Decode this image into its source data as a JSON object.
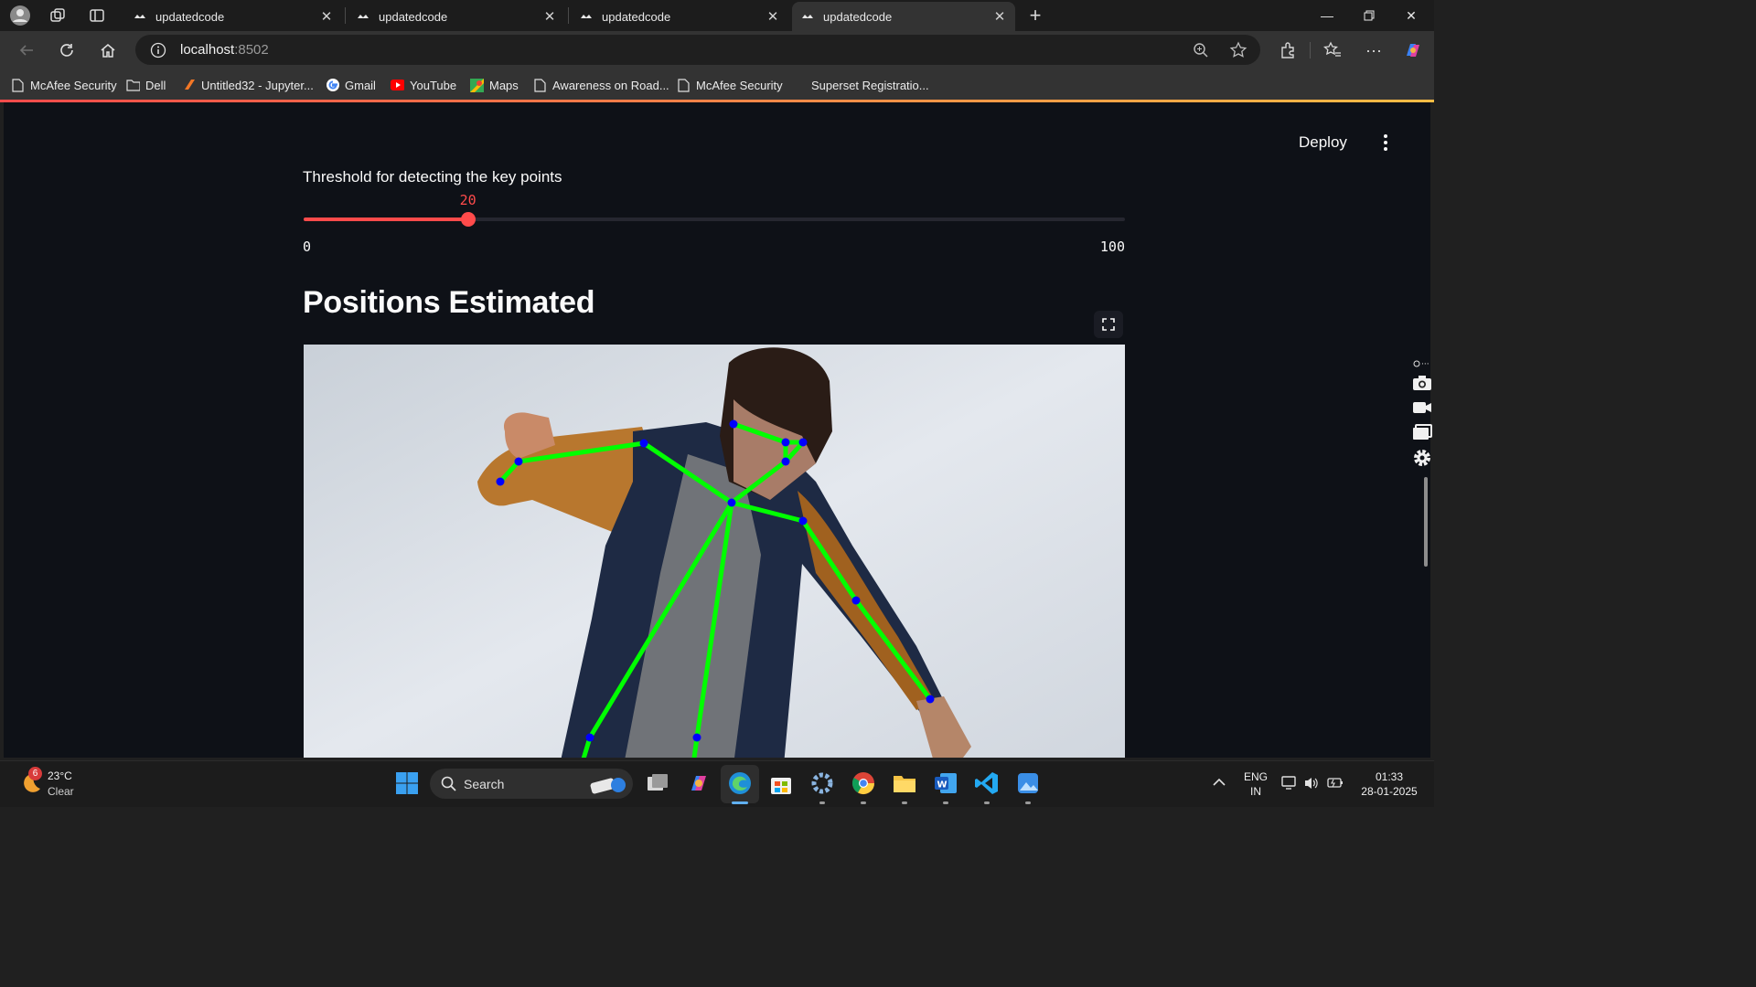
{
  "browser": {
    "tabs": [
      {
        "title": "updatedcode",
        "active": false
      },
      {
        "title": "updatedcode",
        "active": false
      },
      {
        "title": "updatedcode",
        "active": false
      },
      {
        "title": "updatedcode",
        "active": true
      }
    ],
    "address": {
      "host": "localhost",
      "port": ":8502"
    },
    "bookmarks": [
      {
        "label": "McAfee Security",
        "icon": "page-icon"
      },
      {
        "label": "Dell",
        "icon": "folder-icon"
      },
      {
        "label": "Untitled32 - Jupyter...",
        "icon": "jupyter-icon"
      },
      {
        "label": "Gmail",
        "icon": "google-icon"
      },
      {
        "label": "YouTube",
        "icon": "youtube-icon"
      },
      {
        "label": "Maps",
        "icon": "maps-icon"
      },
      {
        "label": "Awareness on Road...",
        "icon": "page-icon"
      },
      {
        "label": "McAfee Security",
        "icon": "page-icon"
      },
      {
        "label": "Superset Registratio...",
        "icon": "superset-icon"
      }
    ]
  },
  "app": {
    "toolbar": {
      "deploy_label": "Deploy"
    },
    "slider": {
      "label": "Threshold for detecting the key points",
      "value": 20,
      "value_text": "20",
      "min": 0,
      "max": 100,
      "min_text": "0",
      "max_text": "100"
    },
    "section_title": "Positions Estimated",
    "pose_image": {
      "line_color": "#00ff00",
      "point_color": "#0000ff"
    },
    "colors": {
      "accent": "#ff4b4b",
      "background": "#0e1117",
      "text": "#fafafa"
    }
  },
  "taskbar": {
    "weather": {
      "temp": "23°C",
      "condition": "Clear",
      "badge": "6"
    },
    "search_label": "Search",
    "tray": {
      "lang": "ENG",
      "region": "IN",
      "time": "01:33",
      "date": "28-01-2025"
    }
  }
}
